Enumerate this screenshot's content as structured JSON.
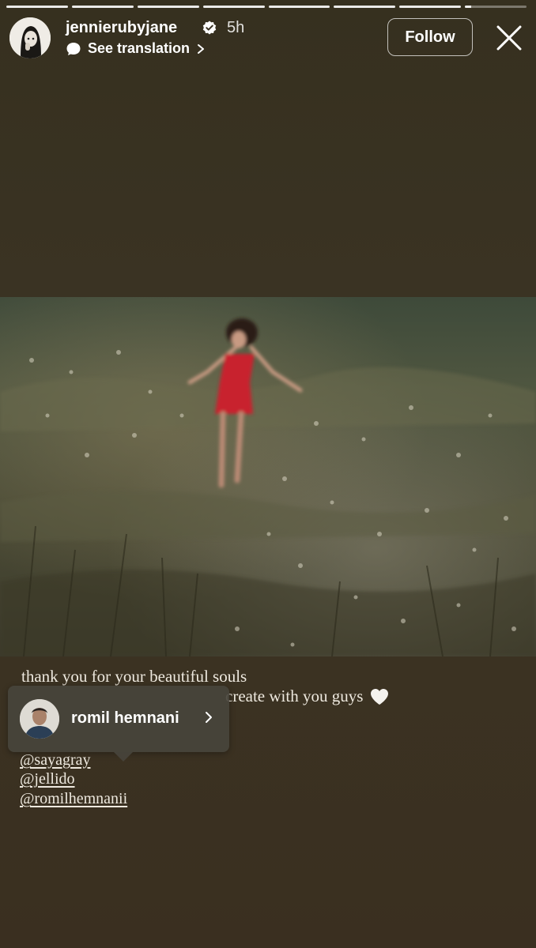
{
  "story": {
    "progress_segments": 8,
    "current_segment_progress": 0.1
  },
  "header": {
    "username": "jennierubyjane",
    "time": "5h",
    "translate_label": "See translation",
    "follow_label": "Follow"
  },
  "caption": {
    "line1": "thank you for your beautiful souls",
    "line2": "create with you guys",
    "mentions": [
      "@sayagray",
      "@jellido",
      "@romilhemnanii"
    ]
  },
  "tag_popup": {
    "name": "romil hemnani"
  }
}
